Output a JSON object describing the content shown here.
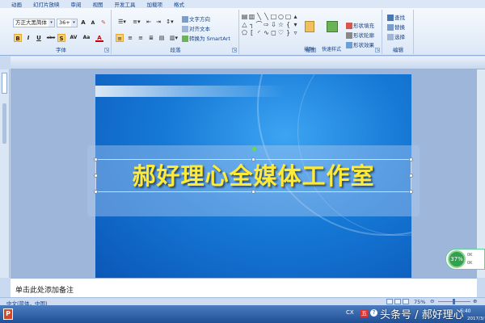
{
  "ribbon": {
    "tabs": [
      {
        "label": "动画",
        "active": false
      },
      {
        "label": "幻灯片放映",
        "active": false
      },
      {
        "label": "审阅",
        "active": false
      },
      {
        "label": "视图",
        "active": false
      },
      {
        "label": "开发工具",
        "active": false
      },
      {
        "label": "加载项",
        "active": false
      },
      {
        "label": "格式",
        "active": false
      }
    ],
    "font": {
      "name": "方正大黑简体",
      "size": "36+",
      "label": "字体",
      "grow_label": "A",
      "shrink_label": "A",
      "bold": "B",
      "italic": "I",
      "underline": "U",
      "strike": "abe",
      "shadow": "S",
      "spacing": "AV",
      "case": "Aa",
      "color": "A"
    },
    "paragraph": {
      "label": "段落",
      "text_direction": "文字方向",
      "align_text": "对齐文本",
      "smartart": "转换为 SmartArt"
    },
    "drawing": {
      "label": "绘图",
      "arrange": "排列",
      "quick_styles": "快速样式",
      "fill": "形状填充",
      "outline": "形状轮廓",
      "effects": "形状效果"
    },
    "editing": {
      "label": "编辑",
      "find": "查找",
      "replace": "替换",
      "select": "选择"
    }
  },
  "slide": {
    "title": "郝好理心全媒体工作室"
  },
  "notes": {
    "placeholder": "单击此处添加备注"
  },
  "status": {
    "language": "中文(简体，中国)",
    "zoom": "75%"
  },
  "widget": {
    "percent": "37%",
    "line1": "0K",
    "line2": "0K"
  },
  "taskbar": {
    "tray_text": "CX",
    "watermark": "头条号 / 郝好理心",
    "clock": "6:40",
    "date": "2017/3/"
  },
  "colors": {
    "title_text": "#ffea3a",
    "slide_bg": "#1679d6",
    "accent_tab": "#e58a2e",
    "widget_green": "#2fa14f"
  }
}
